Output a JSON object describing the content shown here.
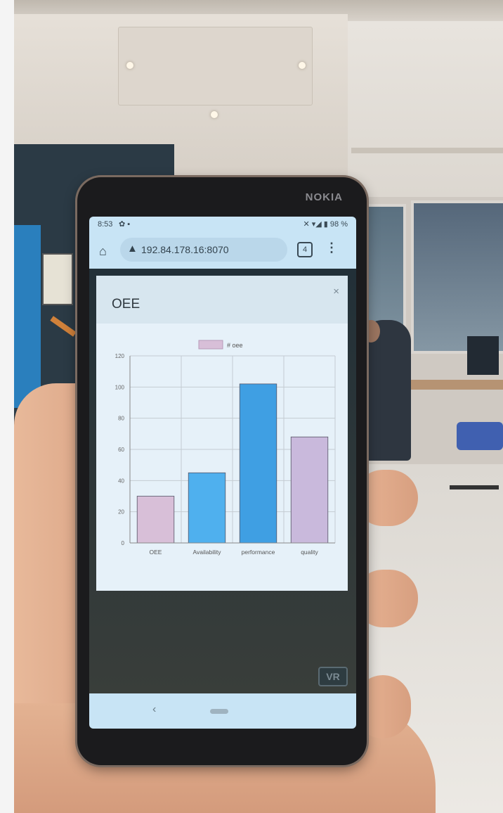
{
  "status_bar": {
    "time": "8:53",
    "left_icons": "✿ ▪",
    "right_icons": "✕ ▾◢ ▮ 98 %"
  },
  "browser": {
    "url": "192.84.178.16:8070",
    "tab_count": "4",
    "menu_icon": "⋮",
    "home_icon": "⌂",
    "warning_icon": "▲"
  },
  "phone": {
    "brand": "NOKIA"
  },
  "modal": {
    "title": "OEE",
    "close_icon": "×"
  },
  "vr_button": {
    "label": "VR"
  },
  "nav": {
    "back_icon": "‹"
  },
  "colors": {
    "bar_pink": "#d8bfd8",
    "bar_blue": "#36a2eb",
    "bar_blue_dark": "#4aa3df"
  },
  "chart_data": {
    "type": "bar",
    "legend": "# oee",
    "categories": [
      "OEE",
      "Availability",
      "performance",
      "quality"
    ],
    "values": [
      30,
      45,
      102,
      68
    ],
    "bar_colors": [
      "#d8bfd8",
      "#4fb0ee",
      "#3f9fe3",
      "#c9b9dc"
    ],
    "ylim": [
      0,
      120
    ],
    "yticks": [
      "0",
      "20",
      "40",
      "60",
      "80",
      "100",
      "120"
    ],
    "grid": true,
    "legend_position": "top-center"
  }
}
